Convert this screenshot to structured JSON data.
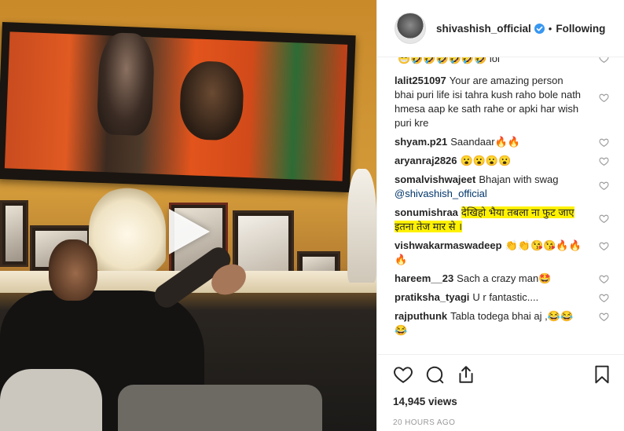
{
  "post": {
    "username": "shivashish_official",
    "dot": "•",
    "follow_label": "Following"
  },
  "comments": [
    {
      "user": "",
      "text": "😁🤣🤣🤣🤣🤣🤣 lol",
      "partial": true
    },
    {
      "user": "lalit251097",
      "text": "Your are amazing person bhai puri life isi tahra kush raho bole nath hmesa aap ke sath rahe or apki har wish puri kre"
    },
    {
      "user": "shyam.p21",
      "text": "Saandaar🔥🔥"
    },
    {
      "user": "aryanraj2826",
      "text": "😮😮😮😮"
    },
    {
      "user": "somalvishwajeet",
      "text": "Bhajan with swag",
      "mention": "@shivashish_official"
    },
    {
      "user": "sonumishraa",
      "text": "देखिहो भैया तबला ना फुट जाए इतना तेज मार से ।",
      "highlighted": true
    },
    {
      "user": "vishwakarmaswadeep",
      "text": "👏👏😘😘🔥🔥🔥"
    },
    {
      "user": "hareem__23",
      "text": "Sach a crazy man🤩"
    },
    {
      "user": "pratiksha_tyagi",
      "text": "U r fantastic...."
    },
    {
      "user": "rajputhunk",
      "text": "Tabla todega bhai aj ,😂😂😂"
    }
  ],
  "stats": {
    "views": "14,945 views",
    "time_ago": "20 HOURS AGO"
  },
  "icons": {
    "like": "heart-icon",
    "comment": "comment-icon",
    "share": "share-icon",
    "save": "bookmark-icon",
    "play": "play-icon",
    "verified": "verified-badge-icon"
  },
  "colors": {
    "verified": "#3897f0",
    "highlight": "#fff200",
    "mention": "#003569"
  }
}
